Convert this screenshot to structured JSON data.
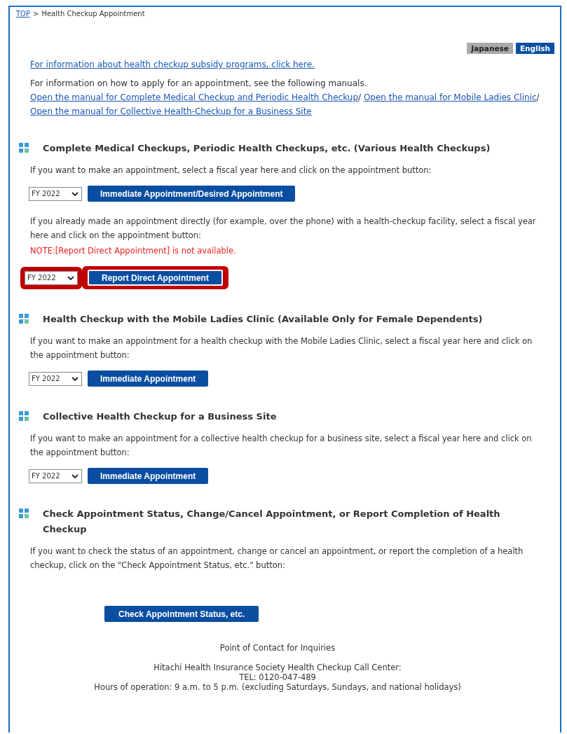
{
  "breadcrumb": {
    "link": "TOP",
    "separator": ">",
    "current": "Health Checkup Appointment"
  },
  "languages": [
    {
      "label": "Japanese",
      "selected": false
    },
    {
      "label": "English",
      "selected": true
    }
  ],
  "subsidy_link": "For information about health checkup subsidy programs, click here.",
  "manuals": {
    "intro": "For information on how to apply for an appointment, see the following manuals.",
    "links": [
      "Open the manual for Complete Medical Checkup and Periodic Health Checkup",
      "Open the manual for Mobile Ladies Clinic",
      "Open the manual for Collective Health-Checkup for a Business Site"
    ],
    "separator": "/"
  },
  "sections": [
    {
      "title": "Complete Medical Checkups, Periodic Health Checkups, etc. (Various Health Checkups)",
      "blocks": [
        {
          "kind": "text",
          "text": "If you want to make an appointment, select a fiscal year here and click on the appointment button:"
        },
        {
          "kind": "controls",
          "year": "FY 2022",
          "button": "Immediate Appointment/Desired Appointment",
          "highlighted": false
        },
        {
          "kind": "text",
          "text": "If you already made an appointment directly (for example, over the phone) with a health-checkup facility, select a fiscal year here and click on the appointment button:"
        },
        {
          "kind": "note",
          "text": "NOTE:[Report Direct Appointment] is not available."
        },
        {
          "kind": "controls",
          "year": "FY 2022",
          "button": "Report Direct Appointment",
          "highlighted": true
        }
      ]
    },
    {
      "title": "Health Checkup with the Mobile Ladies Clinic (Available Only for Female Dependents)",
      "blocks": [
        {
          "kind": "text",
          "text": "If you want to make an appointment for a health checkup with the Mobile Ladies Clinic, select a fiscal year here and click on the appointment button:"
        },
        {
          "kind": "controls",
          "year": "FY 2022",
          "button": "Immediate Appointment",
          "highlighted": false
        }
      ]
    },
    {
      "title": "Collective Health Checkup for a Business Site",
      "blocks": [
        {
          "kind": "text",
          "text": "If you want to make an appointment for a collective health checkup for a business site, select a fiscal year here and click on the appointment button:"
        },
        {
          "kind": "controls",
          "year": "FY 2022",
          "button": "Immediate Appointment",
          "highlighted": false
        }
      ]
    },
    {
      "title": "Check Appointment Status, Change/Cancel Appointment, or Report Completion of Health Checkup",
      "blocks": [
        {
          "kind": "text",
          "text": "If you want to check the status of an appointment, change or cancel an appointment, or report the completion of a health checkup, click on the \"Check Appointment Status, etc.\" button:"
        },
        {
          "kind": "button",
          "button": "Check Appointment Status, etc."
        }
      ]
    }
  ],
  "contact": {
    "title": "Point of Contact for Inquiries",
    "lines": [
      "Hitachi Health Insurance Society Health Checkup Call Center:",
      "TEL: 0120-047-489",
      "Hours of operation: 9 a.m. to 5 p.m. (excluding Saturdays, Sundays, and national holidays)"
    ]
  }
}
